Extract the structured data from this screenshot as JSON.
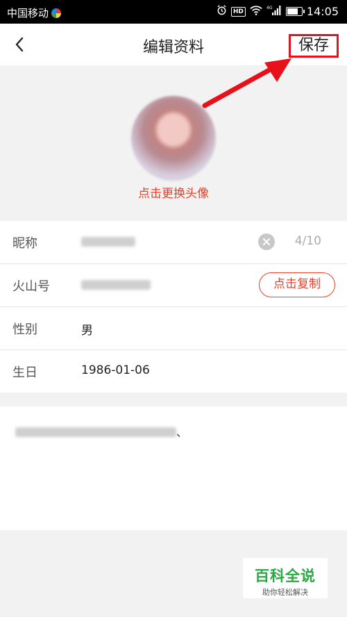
{
  "status_bar": {
    "carrier": "中国移动",
    "hd": "HD",
    "network": "4G",
    "time": "14:05"
  },
  "header": {
    "title": "编辑资料",
    "save_label": "保存"
  },
  "avatar": {
    "change_label": "点击更换头像"
  },
  "form": {
    "nickname": {
      "label": "昵称",
      "counter": "4/10"
    },
    "huoshan_id": {
      "label": "火山号",
      "copy_label": "点击复制"
    },
    "gender": {
      "label": "性别",
      "value": "男"
    },
    "birthday": {
      "label": "生日",
      "value": "1986-01-06"
    }
  },
  "bio": {
    "tail_text": "、"
  },
  "watermark": {
    "title": "百科全说",
    "subtitle": "助你轻松解决"
  },
  "colors": {
    "accent": "#e8402a",
    "annotation": "#e8101a",
    "watermark_green": "#2aa844"
  }
}
